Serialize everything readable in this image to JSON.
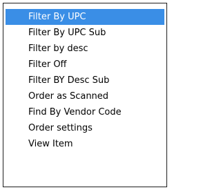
{
  "context_menu": {
    "selected_index": 0,
    "colors": {
      "selected_background": "#3a8ee6",
      "selected_text": "#ffffff",
      "text": "#000000",
      "border": "#1e1e1e"
    },
    "items": [
      {
        "label": "Filter By UPC"
      },
      {
        "label": "Filter By UPC Sub"
      },
      {
        "label": "Filter by desc"
      },
      {
        "label": "Filter Off"
      },
      {
        "label": "Filter BY Desc Sub"
      },
      {
        "label": "Order as Scanned"
      },
      {
        "label": "Find By Vendor Code"
      },
      {
        "label": "Order settings"
      },
      {
        "label": "View Item"
      }
    ]
  }
}
